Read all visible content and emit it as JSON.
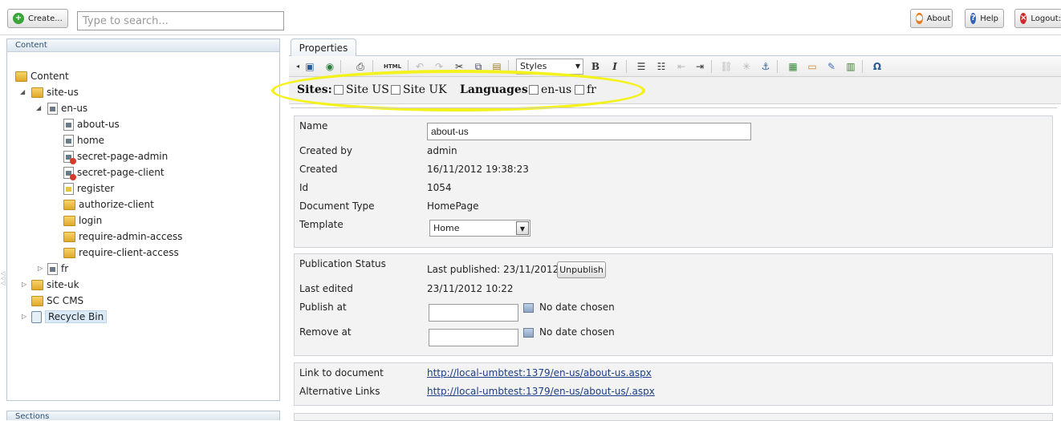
{
  "topbar": {
    "create_label": "Create...",
    "search_placeholder": "Type to search...",
    "about_label": "About",
    "help_label": "Help",
    "logout_label": "Logout:"
  },
  "content_panel": {
    "header": "Content",
    "tree": [
      {
        "label": "Content",
        "icon": "folder-icon"
      },
      {
        "label": "site-us",
        "icon": "folder-icon"
      },
      {
        "label": "en-us",
        "icon": "page-icon"
      },
      {
        "label": "about-us",
        "icon": "page-icon"
      },
      {
        "label": "home",
        "icon": "page-icon"
      },
      {
        "label": "secret-page-admin",
        "icon": "page-protected-icon"
      },
      {
        "label": "secret-page-client",
        "icon": "page-protected-icon"
      },
      {
        "label": "register",
        "icon": "page-icon"
      },
      {
        "label": "authorize-client",
        "icon": "folder-icon"
      },
      {
        "label": "login",
        "icon": "folder-icon"
      },
      {
        "label": "require-admin-access",
        "icon": "folder-icon"
      },
      {
        "label": "require-client-access",
        "icon": "folder-icon"
      },
      {
        "label": "fr",
        "icon": "page-icon"
      },
      {
        "label": "site-uk",
        "icon": "folder-icon"
      },
      {
        "label": "SC CMS",
        "icon": "folder-icon"
      },
      {
        "label": "Recycle Bin",
        "icon": "recycle-bin-icon"
      }
    ],
    "sections_header": "Sections"
  },
  "editor": {
    "tab_label": "Properties",
    "toolbar": {
      "styles_value": "Styles",
      "html_label": "HTML",
      "bold_label": "B",
      "italic_label": "I",
      "omega_label": "Ω"
    },
    "sitebar": {
      "sites_label": "Sites:",
      "site_us_label": "Site US",
      "site_uk_label": "Site UK",
      "languages_label": "Languages:",
      "en_us_label": "en-us",
      "fr_label": "fr"
    },
    "properties": {
      "name_label": "Name",
      "name_value": "about-us",
      "created_by_label": "Created by",
      "created_by_value": "admin",
      "created_label": "Created",
      "created_value": "16/11/2012 19:38:23",
      "id_label": "Id",
      "id_value": "1054",
      "doctype_label": "Document Type",
      "doctype_value": "HomePage",
      "template_label": "Template",
      "template_value": "Home"
    },
    "publication": {
      "status_label": "Publication Status",
      "status_value": "Last published: 23/11/2012",
      "unpublish_label": "Unpublish",
      "last_edited_label": "Last edited",
      "last_edited_value": "23/11/2012 10:22",
      "publish_at_label": "Publish at",
      "publish_at_value": "No date chosen",
      "remove_at_label": "Remove at",
      "remove_at_value": "No date chosen"
    },
    "links": {
      "link_label": "Link to document",
      "link_value": "http://local-umbtest:1379/en-us/about-us.aspx",
      "alt_label": "Alternative Links",
      "alt_value": "http://local-umbtest:1379/en-us/about-us/.aspx"
    }
  },
  "colors": {
    "highlight_ellipse": "#f4f21c",
    "panel_header_text": "#2c4f74",
    "link": "#1a3f88"
  }
}
